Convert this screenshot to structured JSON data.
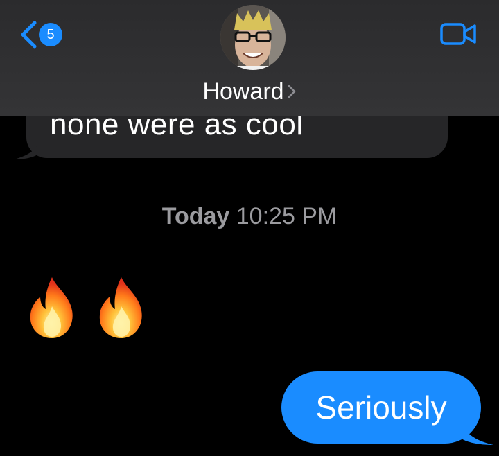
{
  "header": {
    "back_badge": "5",
    "contact_name": "Howard",
    "icons": {
      "back": "chevron-left-icon",
      "video": "video-camera-icon",
      "contact_chevron": "chevron-right-icon"
    }
  },
  "messages": {
    "incoming_partial_text": "none were as cool",
    "timestamp_day": "Today",
    "timestamp_time": "10:25 PM",
    "flames": [
      "fire-emoji",
      "fire-emoji"
    ],
    "outgoing_text": "Seriously"
  },
  "colors": {
    "accent": "#1a8cff",
    "incoming_bubble": "#262628",
    "header_bg": "#2e2e30",
    "timestamp": "#9b9b9f"
  }
}
